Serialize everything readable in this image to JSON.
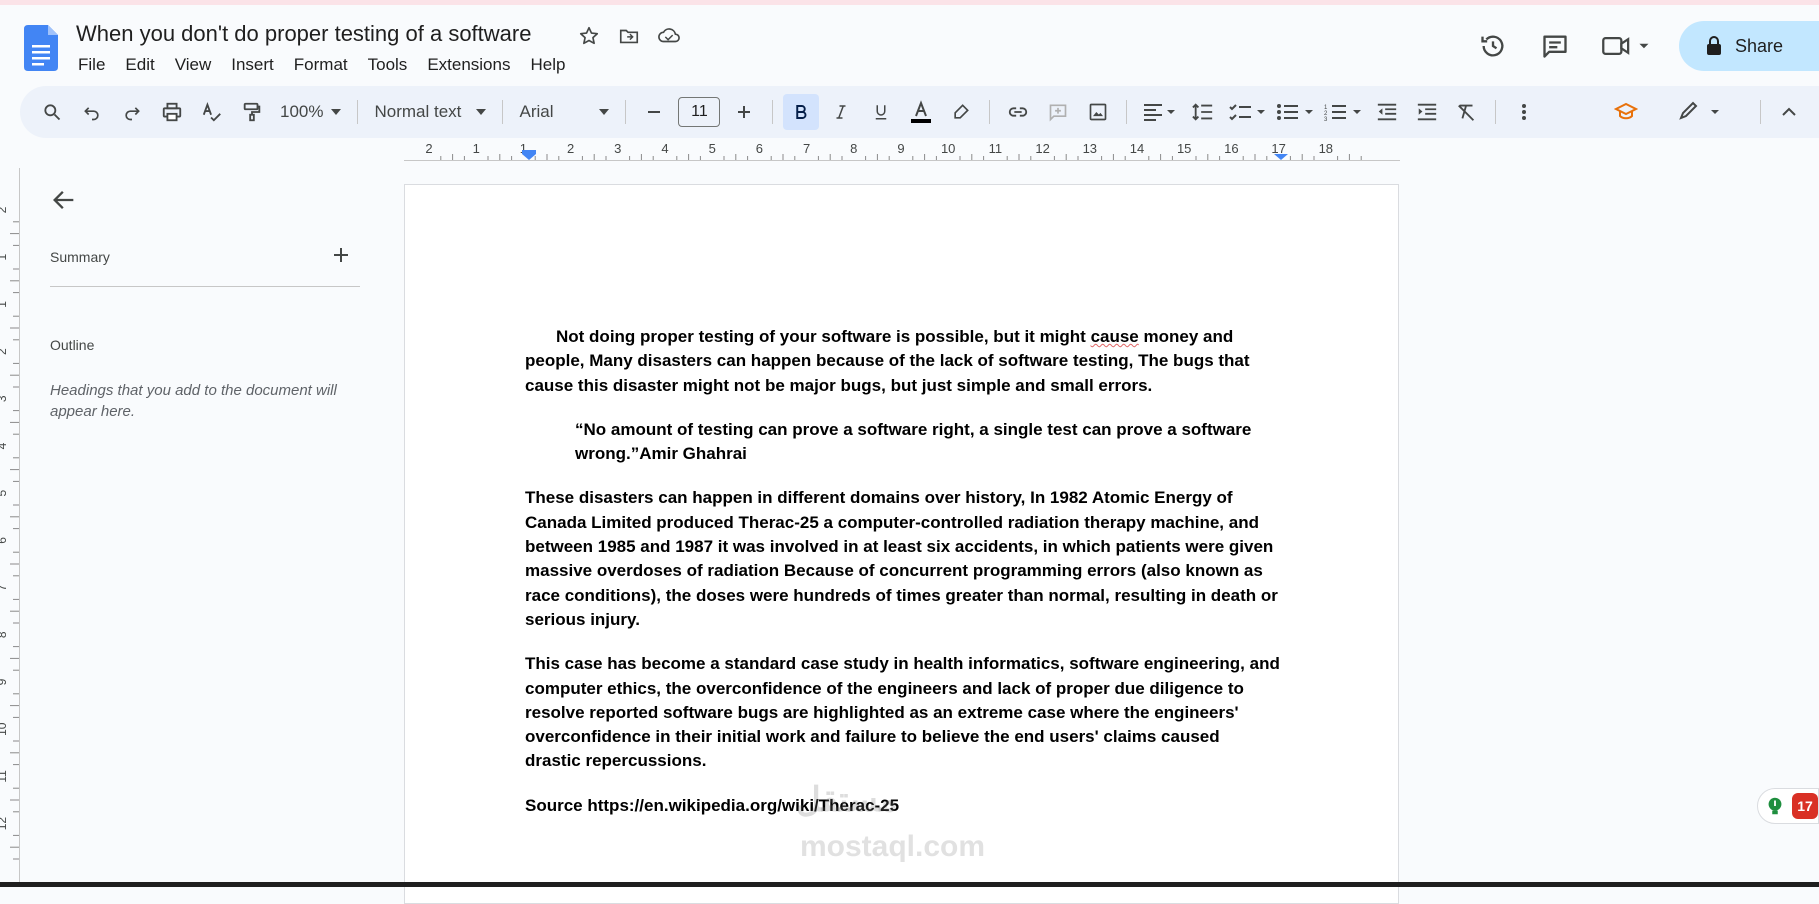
{
  "document": {
    "title": "When you don't do proper testing of a software"
  },
  "menu": [
    "File",
    "Edit",
    "View",
    "Insert",
    "Format",
    "Tools",
    "Extensions",
    "Help"
  ],
  "share": {
    "label": "Share"
  },
  "toolbar": {
    "zoom": "100%",
    "style": "Normal text",
    "font": "Arial",
    "font_size": "11"
  },
  "ruler": {
    "labels": [
      "2",
      "1",
      "1",
      "2",
      "3",
      "4",
      "5",
      "6",
      "7",
      "8",
      "9",
      "10",
      "11",
      "12",
      "13",
      "14",
      "15",
      "16",
      "17",
      "18"
    ]
  },
  "vruler": {
    "labels": [
      "2",
      "1",
      "1",
      "2",
      "3",
      "4",
      "5",
      "6",
      "7",
      "8",
      "9",
      "10",
      "11",
      "12"
    ]
  },
  "sidebar": {
    "summary_label": "Summary",
    "outline_label": "Outline",
    "outline_hint": "Headings that you add to the document will appear here."
  },
  "body": {
    "p1_before": "Not doing proper testing of your software is possible, but it might ",
    "p1_squiggle": "cause",
    "p1_after": " money and people, Many disasters can happen because of the lack of software testing, The bugs that cause this disaster might not be major bugs, but just simple and small errors.",
    "quote": "“No amount of testing can prove a software right, a single test can prove a software wrong.”Amir Ghahrai",
    "p2": "These disasters can happen in different domains over history, In 1982  Atomic Energy of Canada Limited produced  Therac-25  a computer-controlled radiation therapy machine, and between 1985 and 1987 it was involved in at least six accidents, in which patients were given massive overdoses of radiation Because of concurrent programming errors (also known as race conditions), the doses were hundreds of times greater than normal, resulting in death or serious injury.",
    "p3": "This case has become a standard case study in health informatics, software engineering, and computer ethics, the overconfidence of the engineers and lack of proper due diligence to resolve reported software bugs are highlighted as an extreme case where the engineers' overconfidence in their initial work and failure to believe the end users' claims caused drastic repercussions.",
    "source": "Source https://en.wikipedia.org/wiki/Therac-25"
  },
  "watermark": {
    "line1": "مستقل",
    "line2": "mostaql.com"
  },
  "badge": {
    "count": "17"
  },
  "colors": {
    "accent": "#c2e7ff",
    "toolbar_bg": "#edf2fa",
    "doc_blue": "#4285f4",
    "active_btn": "#d3e3fd"
  }
}
